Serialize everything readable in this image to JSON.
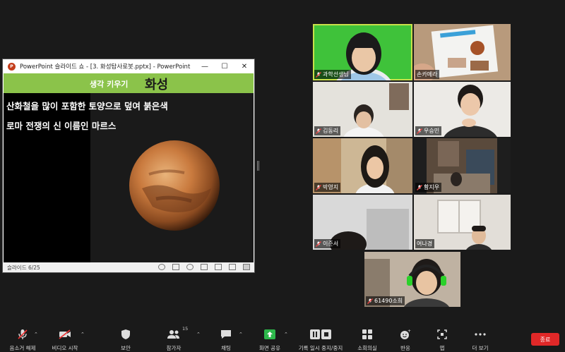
{
  "ppt": {
    "window_title": "PowerPoint 슬라이드 쇼 - [3. 화성탐사로봇.pptx] - PowerPoint",
    "minimize_glyph": "—",
    "maximize_glyph": "☐",
    "close_glyph": "✕",
    "slide": {
      "subheading": "생각 키우기",
      "heading": "화성",
      "line1": "산화철을 많이 포함한 토양으로 덮여 붉은색",
      "line2": "로마 전쟁의 신 이름인 마르스"
    },
    "status": "슬라이드 6/25"
  },
  "participants": [
    {
      "name": "과학선생님",
      "muted": true,
      "active": true
    },
    {
      "name": "손카메라",
      "muted": false
    },
    {
      "name": "김동리",
      "muted": true
    },
    {
      "name": "우승민",
      "muted": true
    },
    {
      "name": "박영지",
      "muted": true
    },
    {
      "name": "황지우",
      "muted": true
    },
    {
      "name": "이준서",
      "muted": true
    },
    {
      "name": "여나경",
      "muted": false
    },
    {
      "name": "61490소희",
      "muted": true
    }
  ],
  "toolbar": {
    "unmute": "음소거 해제",
    "start_video": "비디오 시작",
    "security": "보안",
    "participants": "참가자",
    "participants_count": "15",
    "chat": "채팅",
    "share": "화면 공유",
    "record": "기록 일시 중지/중지",
    "breakout": "소회의실",
    "reactions": "반응",
    "apps": "앱",
    "more": "더 보기",
    "end": "종료"
  },
  "colors": {
    "accent_green": "#8bc34a",
    "active_border": "#c8e04a",
    "end_red": "#e02828",
    "share_green": "#2db84b"
  }
}
